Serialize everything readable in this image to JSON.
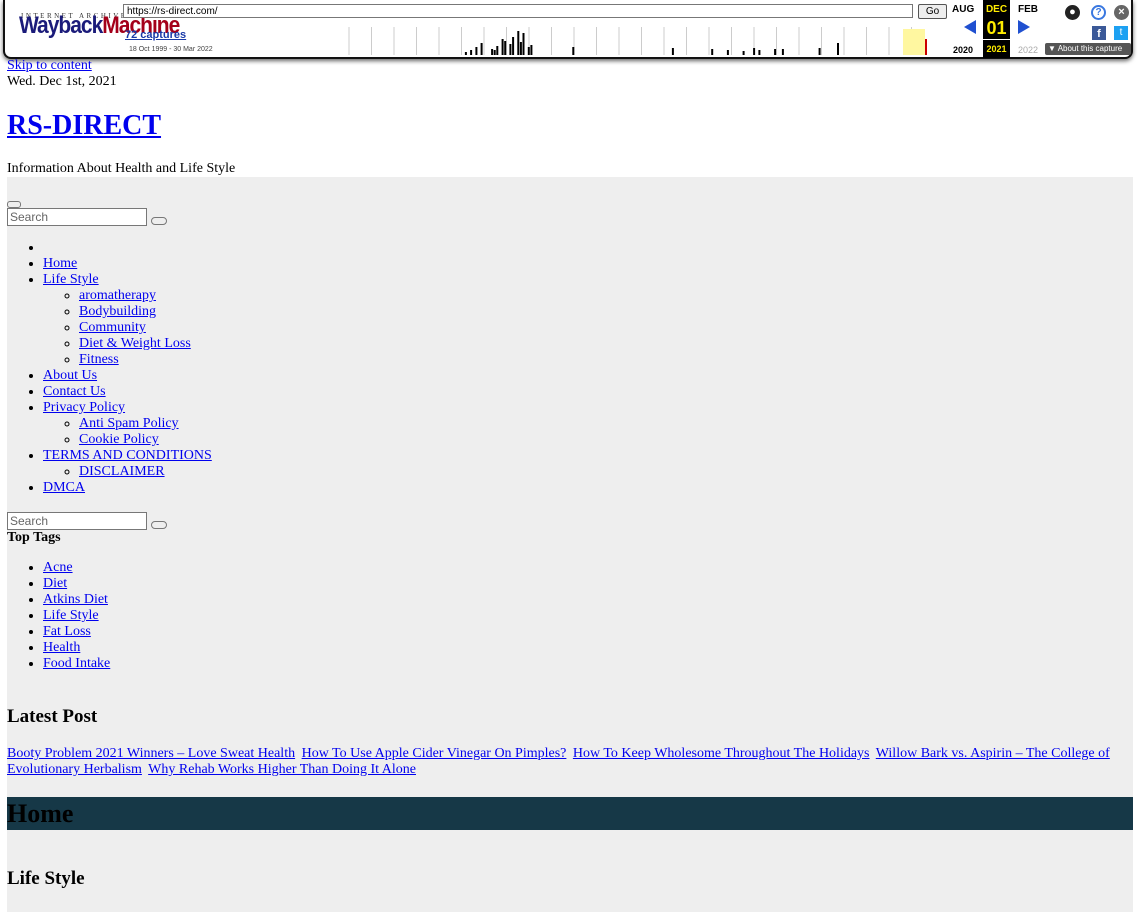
{
  "wayback": {
    "ia_label": "INTERNET ARCHIVE",
    "logo_part1": "Wayback",
    "logo_part2": "Machine",
    "url": "https://rs-direct.com/",
    "go_label": "Go",
    "captures": "72 captures",
    "range": "18 Oct 1999 - 30 Mar 2022",
    "month_prev": "AUG",
    "month_cur": "DEC",
    "month_next": "FEB",
    "day": "01",
    "year_prev": "2020",
    "year_cur": "2021",
    "year_next": "2022",
    "about_label": "▼ About this capture",
    "sparkline_heights": [
      0,
      0,
      0,
      0,
      0,
      0,
      0,
      0,
      0,
      0,
      0,
      0,
      0,
      0,
      0,
      0,
      0,
      0,
      0,
      0,
      0,
      0,
      0,
      0,
      0,
      0,
      0,
      0,
      0,
      0,
      0,
      0,
      0,
      0,
      0,
      0,
      0,
      0,
      0,
      0,
      0,
      0,
      0,
      0,
      0,
      3,
      0,
      5,
      0,
      8,
      0,
      12,
      0,
      0,
      0,
      6,
      5,
      9,
      0,
      16,
      14,
      0,
      11,
      18,
      0,
      24,
      13,
      22,
      0,
      8,
      10,
      0,
      0,
      0,
      0,
      0,
      0,
      0,
      0,
      0,
      0,
      0,
      0,
      0,
      0,
      0,
      8,
      0,
      0,
      0,
      0,
      0,
      0,
      0,
      0,
      0,
      0,
      0,
      0,
      0,
      0,
      0,
      0,
      0,
      0,
      0,
      0,
      0,
      0,
      0,
      0,
      0,
      0,
      0,
      0,
      0,
      0,
      0,
      0,
      0,
      0,
      0,
      0,
      0,
      7,
      0,
      0,
      0,
      0,
      0,
      0,
      0,
      0,
      0,
      0,
      0,
      0,
      0,
      0,
      6,
      0,
      0,
      0,
      0,
      0,
      5,
      0,
      0,
      0,
      0,
      0,
      4,
      0,
      0,
      0,
      7,
      0,
      5,
      0,
      0,
      0,
      0,
      0,
      6,
      0,
      0,
      6,
      0,
      0,
      0,
      0,
      0,
      0,
      0,
      0,
      0,
      0,
      0,
      0,
      0,
      7,
      0,
      0,
      0,
      0,
      0,
      0,
      12,
      0,
      0,
      0,
      0,
      0,
      0,
      0,
      0,
      0,
      0,
      0,
      0,
      0,
      0,
      0,
      0,
      0,
      0,
      0,
      0,
      0,
      0,
      0,
      0,
      0,
      0,
      0,
      0,
      0,
      0,
      0,
      0,
      0,
      0,
      0,
      0,
      0,
      0,
      0,
      0,
      0
    ]
  },
  "page": {
    "skip": "Skip to content",
    "date": "Wed. Dec 1st, 2021",
    "site_title": "RS-DIRECT",
    "tagline": "Information About Health and Life Style",
    "search_placeholder": "Search"
  },
  "menu": {
    "home": "Home",
    "life_style": "Life Style",
    "life_style_sub": [
      "aromatherapy",
      "Bodybuilding",
      "Community",
      "Diet & Weight Loss",
      "Fitness"
    ],
    "about": "About Us",
    "contact": "Contact Us",
    "privacy": "Privacy Policy",
    "privacy_sub": [
      "Anti Spam Policy",
      "Cookie Policy"
    ],
    "terms": "TERMS AND CONDITIONS",
    "terms_sub": [
      "DISCLAIMER"
    ],
    "dmca": "DMCA"
  },
  "top_tags": {
    "heading": "Top Tags",
    "items": [
      "Acne",
      "Diet",
      "Atkins Diet",
      "Life Style",
      "Fat Loss",
      "Health",
      "Food Intake"
    ]
  },
  "latest": {
    "heading": "Latest Post",
    "posts": [
      "Booty Problem 2021 Winners – Love Sweat Health",
      "How To Use Apple Cider Vinegar On Pimples?",
      "How To Keep Wholesome Throughout The Holidays",
      "Willow Bark vs. Aspirin – The College of Evolutionary Herbalism",
      "Why Rehab Works Higher Than Doing It Alone"
    ]
  },
  "sections": {
    "home": "Home",
    "life_style": "Life Style"
  }
}
